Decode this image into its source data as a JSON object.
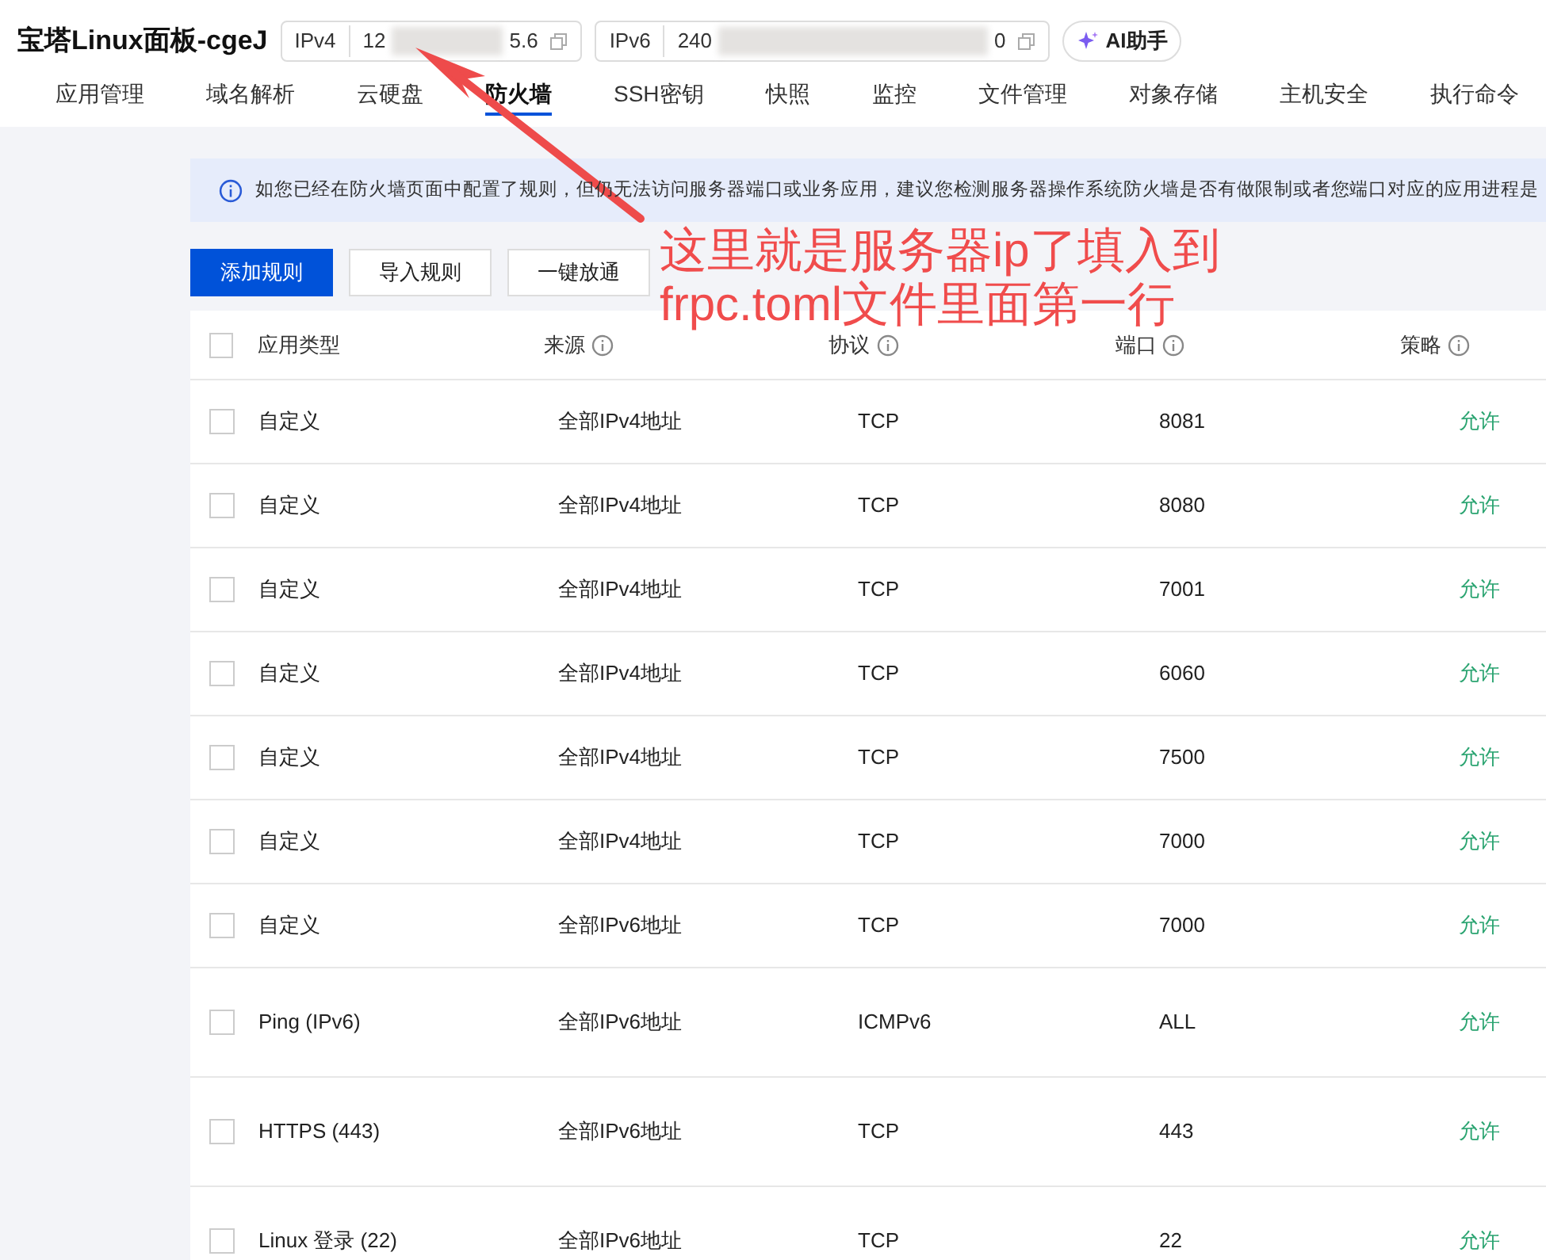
{
  "header": {
    "title": "宝塔Linux面板-cgeJ",
    "ipv4": {
      "label": "IPv4",
      "start": "12",
      "end": "5.6"
    },
    "ipv6": {
      "label": "IPv6",
      "start": "240",
      "end": "0"
    },
    "assistant": "AI助手"
  },
  "tabs": [
    {
      "label": "应用管理",
      "selected": false
    },
    {
      "label": "域名解析",
      "selected": false
    },
    {
      "label": "云硬盘",
      "selected": false
    },
    {
      "label": "防火墙",
      "selected": true
    },
    {
      "label": "SSH密钥",
      "selected": false
    },
    {
      "label": "快照",
      "selected": false
    },
    {
      "label": "监控",
      "selected": false
    },
    {
      "label": "文件管理",
      "selected": false
    },
    {
      "label": "对象存储",
      "selected": false
    },
    {
      "label": "主机安全",
      "selected": false
    },
    {
      "label": "执行命令",
      "selected": false
    }
  ],
  "notice": "如您已经在防火墙页面中配置了规则，但仍无法访问服务器端口或业务应用，建议您检测服务器操作系统防火墙是否有做限制或者您端口对应的应用进程是",
  "toolbar": [
    {
      "label": "添加规则",
      "kind": "primary"
    },
    {
      "label": "导入规则",
      "kind": "default"
    },
    {
      "label": "一键放通",
      "kind": "default"
    }
  ],
  "table": {
    "all_checked": false,
    "columns": [
      {
        "label": "应用类型",
        "info": false
      },
      {
        "label": "来源",
        "info": true
      },
      {
        "label": "协议",
        "info": true
      },
      {
        "label": "端口",
        "info": true
      },
      {
        "label": "策略",
        "info": true
      }
    ],
    "rows": [
      {
        "type": "自定义",
        "source": "全部IPv4地址",
        "protocol": "TCP",
        "port": "8081",
        "policy": "允许",
        "checked": false,
        "tall": false
      },
      {
        "type": "自定义",
        "source": "全部IPv4地址",
        "protocol": "TCP",
        "port": "8080",
        "policy": "允许",
        "checked": false,
        "tall": false
      },
      {
        "type": "自定义",
        "source": "全部IPv4地址",
        "protocol": "TCP",
        "port": "7001",
        "policy": "允许",
        "checked": false,
        "tall": false
      },
      {
        "type": "自定义",
        "source": "全部IPv4地址",
        "protocol": "TCP",
        "port": "6060",
        "policy": "允许",
        "checked": false,
        "tall": false
      },
      {
        "type": "自定义",
        "source": "全部IPv4地址",
        "protocol": "TCP",
        "port": "7500",
        "policy": "允许",
        "checked": false,
        "tall": false
      },
      {
        "type": "自定义",
        "source": "全部IPv4地址",
        "protocol": "TCP",
        "port": "7000",
        "policy": "允许",
        "checked": false,
        "tall": false
      },
      {
        "type": "自定义",
        "source": "全部IPv6地址",
        "protocol": "TCP",
        "port": "7000",
        "policy": "允许",
        "checked": false,
        "tall": false
      },
      {
        "type": "Ping (IPv6)",
        "source": "全部IPv6地址",
        "protocol": "ICMPv6",
        "port": "ALL",
        "policy": "允许",
        "checked": false,
        "tall": true
      },
      {
        "type": "HTTPS (443)",
        "source": "全部IPv6地址",
        "protocol": "TCP",
        "port": "443",
        "policy": "允许",
        "checked": false,
        "tall": true
      },
      {
        "type": "Linux 登录 (22)",
        "source": "全部IPv6地址",
        "protocol": "TCP",
        "port": "22",
        "policy": "允许",
        "checked": false,
        "tall": true
      }
    ]
  },
  "annotation": {
    "lines": [
      "这里就是服务器ip了填入到",
      "frpc.toml文件里面第一行"
    ]
  }
}
